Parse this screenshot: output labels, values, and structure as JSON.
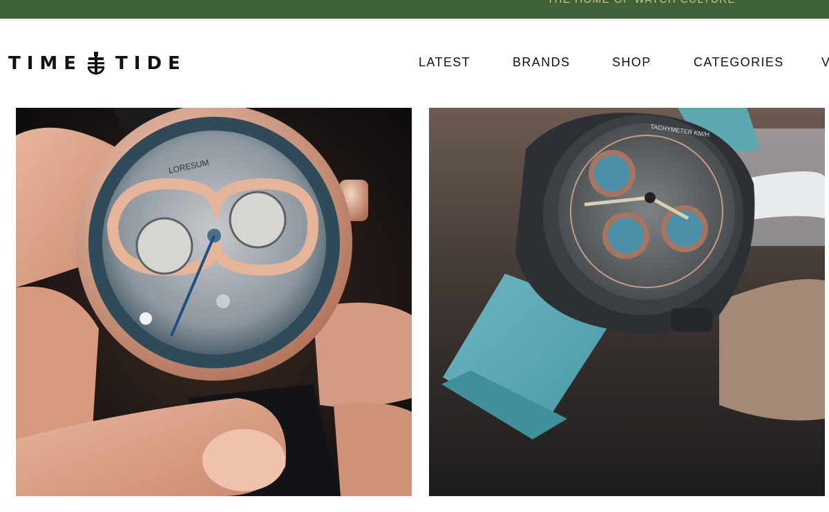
{
  "banner": {
    "tagline": "THE HOME OF WATCH CULTURE"
  },
  "logo": {
    "left_text": "TIME",
    "right_text": "TIDE",
    "icon": "anchor-icon"
  },
  "nav": {
    "items": [
      "LATEST",
      "BRANDS",
      "SHOP",
      "CATEGORIES",
      "V"
    ]
  },
  "tiles": [
    {
      "brand_dial_text": "LORESUM"
    },
    {
      "brand_dial_text": "TACHYMETER KM/H"
    }
  ],
  "colors": {
    "banner_bg": "#3f6138",
    "banner_text": "#d7c98a",
    "text": "#111111"
  }
}
